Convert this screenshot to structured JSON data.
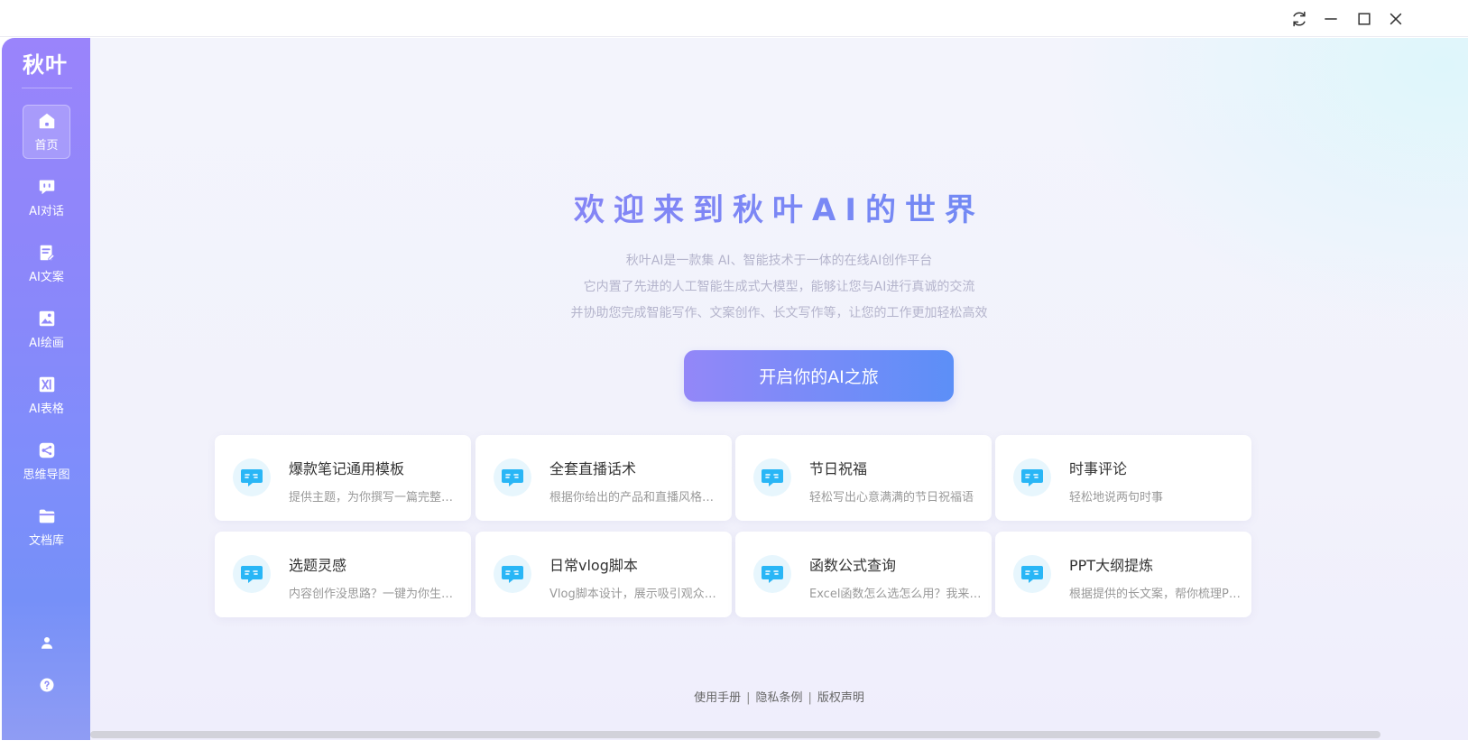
{
  "window": {
    "controls": [
      "refresh-icon",
      "minimize-icon",
      "maximize-icon",
      "close-icon"
    ]
  },
  "sidebar": {
    "logo": "秋叶",
    "items": [
      {
        "label": "首页",
        "icon": "home-icon",
        "active": true
      },
      {
        "label": "AI对话",
        "icon": "chat-icon",
        "active": false
      },
      {
        "label": "AI文案",
        "icon": "document-edit-icon",
        "active": false
      },
      {
        "label": "AI绘画",
        "icon": "image-icon",
        "active": false
      },
      {
        "label": "AI表格",
        "icon": "excel-icon",
        "active": false
      },
      {
        "label": "思维导图",
        "icon": "mindmap-icon",
        "active": false
      },
      {
        "label": "文档库",
        "icon": "folder-icon",
        "active": false
      }
    ],
    "bottom": [
      "user-icon",
      "help-icon"
    ]
  },
  "hero": {
    "title": "欢迎来到秋叶AI的世界",
    "desc": [
      "秋叶AI是一款集 AI、智能技术于一体的在线AI创作平台",
      "它内置了先进的人工智能生成式大模型，能够让您与AI进行真诚的交流",
      "并协助您完成智能写作、文案创作、长文写作等，让您的工作更加轻松高效"
    ],
    "cta": "开启你的AI之旅"
  },
  "cards": [
    {
      "title": "爆款笔记通用模板",
      "desc": "提供主题，为你撰写一篇完整的爆款笔记"
    },
    {
      "title": "全套直播话术",
      "desc": "根据你给出的产品和直播风格生成话术"
    },
    {
      "title": "节日祝福",
      "desc": "轻松写出心意满满的节日祝福语"
    },
    {
      "title": "时事评论",
      "desc": "轻松地说两句时事"
    },
    {
      "title": "选题灵感",
      "desc": "内容创作没思路？一键为你生成选题"
    },
    {
      "title": "日常vlog脚本",
      "desc": "Vlog脚本设计，展示吸引观众的内容"
    },
    {
      "title": "函数公式查询",
      "desc": "Excel函数怎么选怎么用？我来告诉你"
    },
    {
      "title": "PPT大纲提炼",
      "desc": "根据提供的长文案，帮你梳理PPT大纲"
    }
  ],
  "footer": {
    "links": [
      "使用手册",
      "隐私条例",
      "版权声明"
    ],
    "separator": "|"
  },
  "colors": {
    "accent": "#7b87f5",
    "sidebar_top": "#9a84fb",
    "sidebar_bottom": "#7690f8",
    "card_icon": "#29b6f6"
  }
}
